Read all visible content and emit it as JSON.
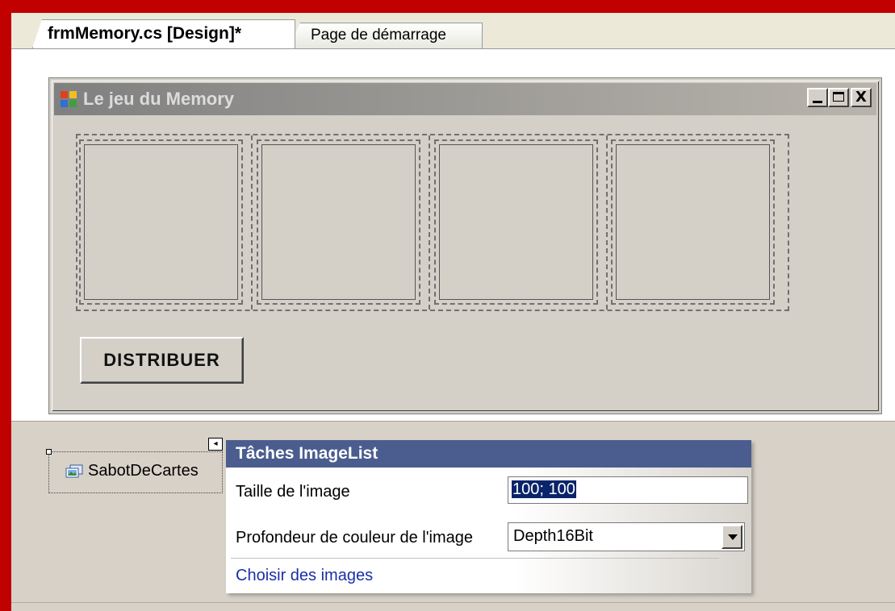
{
  "tabs": [
    {
      "label": "frmMemory.cs [Design]*",
      "active": true
    },
    {
      "label": "Page de démarrage",
      "active": false
    }
  ],
  "form": {
    "title": "Le jeu du Memory",
    "title_icon": "form-app-icon",
    "controls": {
      "minimize": "_",
      "maximize": "□",
      "close": "X"
    },
    "distribute_button": "DISTRIBUER",
    "picture_box_count": 4
  },
  "tray": {
    "component_name": "SabotDeCartes",
    "component_icon": "imagelist-icon",
    "smart_tag_glyph": "◂"
  },
  "smart_panel": {
    "title": "Tâches ImageList",
    "image_size_label": "Taille de l'image",
    "image_size_value": "100; 100",
    "color_depth_label": "Profondeur de couleur de l'image",
    "color_depth_value": "Depth16Bit",
    "choose_images_link": "Choisir des images"
  },
  "colors": {
    "frame": "#c10000",
    "panel_header": "#4a5d8e",
    "link": "#1a2fa8",
    "selection": "#0a246a"
  }
}
